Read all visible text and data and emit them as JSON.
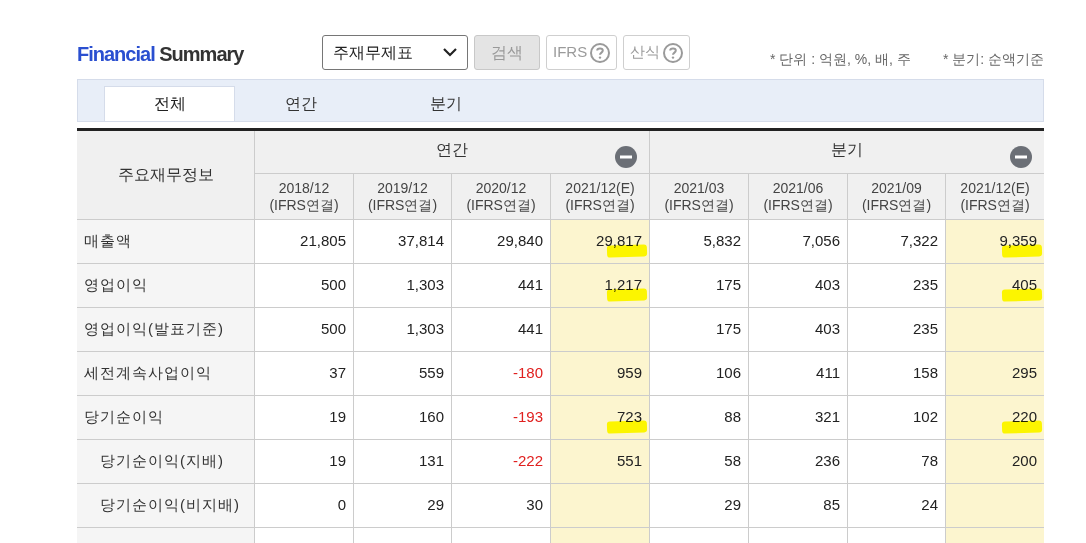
{
  "title": {
    "part1": "Financial",
    "part2": "Summary"
  },
  "controls": {
    "select": "주재무제표",
    "buttons": [
      {
        "label": "검색",
        "kind": "plain"
      },
      {
        "label": "IFRS",
        "kind": "help"
      },
      {
        "label": "산식",
        "kind": "help"
      }
    ]
  },
  "notes": [
    "* 단위 : 억원, %, 배, 주",
    "* 분기: 순액기준"
  ],
  "tabs": [
    {
      "label": "전체",
      "selected": true
    },
    {
      "label": "연간",
      "selected": false
    },
    {
      "label": "분기",
      "selected": false
    }
  ],
  "table": {
    "corner": "주요재무정보",
    "groups": [
      {
        "label": "연간"
      },
      {
        "label": "분기"
      }
    ],
    "columns": [
      {
        "period": "2018/12",
        "basis": "(IFRS연결)",
        "estimate": false
      },
      {
        "period": "2019/12",
        "basis": "(IFRS연결)",
        "estimate": false
      },
      {
        "period": "2020/12",
        "basis": "(IFRS연결)",
        "estimate": false
      },
      {
        "period": "2021/12(E)",
        "basis": "(IFRS연결)",
        "estimate": true
      },
      {
        "period": "2021/03",
        "basis": "(IFRS연결)",
        "estimate": false
      },
      {
        "period": "2021/06",
        "basis": "(IFRS연결)",
        "estimate": false
      },
      {
        "period": "2021/09",
        "basis": "(IFRS연결)",
        "estimate": false
      },
      {
        "period": "2021/12(E)",
        "basis": "(IFRS연결)",
        "estimate": true
      }
    ],
    "rows": [
      {
        "label": "매출액",
        "indented": false,
        "cells": [
          {
            "text": "21,805",
            "negative": false,
            "highlighted": false
          },
          {
            "text": "37,814",
            "negative": false,
            "highlighted": false
          },
          {
            "text": "29,840",
            "negative": false,
            "highlighted": false
          },
          {
            "text": "29,817",
            "negative": false,
            "highlighted": true
          },
          {
            "text": "5,832",
            "negative": false,
            "highlighted": false
          },
          {
            "text": "7,056",
            "negative": false,
            "highlighted": false
          },
          {
            "text": "7,322",
            "negative": false,
            "highlighted": false
          },
          {
            "text": "9,359",
            "negative": false,
            "highlighted": true
          }
        ]
      },
      {
        "label": "영업이익",
        "indented": false,
        "cells": [
          {
            "text": "500",
            "negative": false,
            "highlighted": false
          },
          {
            "text": "1,303",
            "negative": false,
            "highlighted": false
          },
          {
            "text": "441",
            "negative": false,
            "highlighted": false
          },
          {
            "text": "1,217",
            "negative": false,
            "highlighted": true
          },
          {
            "text": "175",
            "negative": false,
            "highlighted": false
          },
          {
            "text": "403",
            "negative": false,
            "highlighted": false
          },
          {
            "text": "235",
            "negative": false,
            "highlighted": false
          },
          {
            "text": "405",
            "negative": false,
            "highlighted": true
          }
        ]
      },
      {
        "label": "영업이익(발표기준)",
        "indented": false,
        "cells": [
          {
            "text": "500",
            "negative": false,
            "highlighted": false
          },
          {
            "text": "1,303",
            "negative": false,
            "highlighted": false
          },
          {
            "text": "441",
            "negative": false,
            "highlighted": false
          },
          {
            "negative": false,
            "highlighted": false
          },
          {
            "text": "175",
            "negative": false,
            "highlighted": false
          },
          {
            "text": "403",
            "negative": false,
            "highlighted": false
          },
          {
            "text": "235",
            "negative": false,
            "highlighted": false
          },
          {
            "negative": false,
            "highlighted": false
          }
        ]
      },
      {
        "label": "세전계속사업이익",
        "indented": false,
        "cells": [
          {
            "text": "37",
            "negative": false,
            "highlighted": false
          },
          {
            "text": "559",
            "negative": false,
            "highlighted": false
          },
          {
            "text": "-180",
            "negative": true,
            "highlighted": false
          },
          {
            "text": "959",
            "negative": false,
            "highlighted": false
          },
          {
            "text": "106",
            "negative": false,
            "highlighted": false
          },
          {
            "text": "411",
            "negative": false,
            "highlighted": false
          },
          {
            "text": "158",
            "negative": false,
            "highlighted": false
          },
          {
            "text": "295",
            "negative": false,
            "highlighted": false
          }
        ]
      },
      {
        "label": "당기순이익",
        "indented": false,
        "cells": [
          {
            "text": "19",
            "negative": false,
            "highlighted": false
          },
          {
            "text": "160",
            "negative": false,
            "highlighted": false
          },
          {
            "text": "-193",
            "negative": true,
            "highlighted": false
          },
          {
            "text": "723",
            "negative": false,
            "highlighted": true
          },
          {
            "text": "88",
            "negative": false,
            "highlighted": false
          },
          {
            "text": "321",
            "negative": false,
            "highlighted": false
          },
          {
            "text": "102",
            "negative": false,
            "highlighted": false
          },
          {
            "text": "220",
            "negative": false,
            "highlighted": true
          }
        ]
      },
      {
        "label": "당기순이익(지배)",
        "indented": true,
        "cells": [
          {
            "text": "19",
            "negative": false,
            "highlighted": false
          },
          {
            "text": "131",
            "negative": false,
            "highlighted": false
          },
          {
            "text": "-222",
            "negative": true,
            "highlighted": false
          },
          {
            "text": "551",
            "negative": false,
            "highlighted": false
          },
          {
            "text": "58",
            "negative": false,
            "highlighted": false
          },
          {
            "text": "236",
            "negative": false,
            "highlighted": false
          },
          {
            "text": "78",
            "negative": false,
            "highlighted": false
          },
          {
            "text": "200",
            "negative": false,
            "highlighted": false
          }
        ]
      },
      {
        "label": "당기순이익(비지배)",
        "indented": true,
        "cells": [
          {
            "text": "0",
            "negative": false,
            "highlighted": false
          },
          {
            "text": "29",
            "negative": false,
            "highlighted": false
          },
          {
            "text": "30",
            "negative": false,
            "highlighted": false
          },
          {
            "negative": false,
            "highlighted": false
          },
          {
            "text": "29",
            "negative": false,
            "highlighted": false
          },
          {
            "text": "85",
            "negative": false,
            "highlighted": false
          },
          {
            "text": "24",
            "negative": false,
            "highlighted": false
          },
          {
            "negative": false,
            "highlighted": false
          }
        ]
      }
    ]
  }
}
